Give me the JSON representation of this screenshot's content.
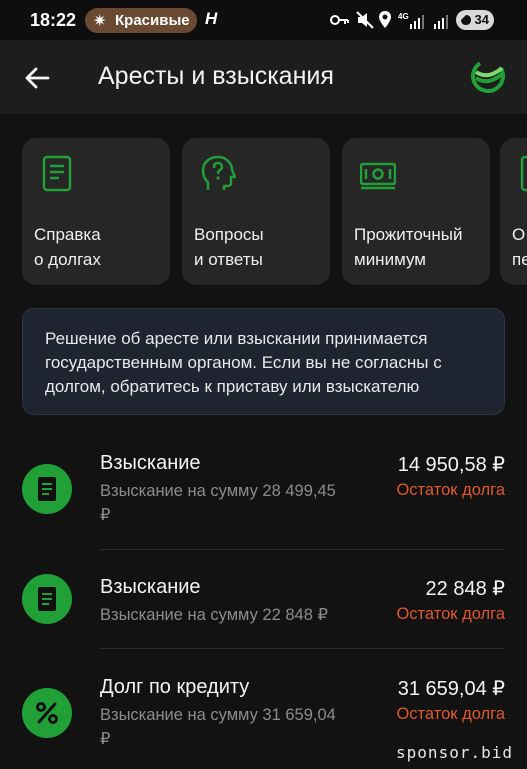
{
  "status_bar": {
    "time": "18:22",
    "notification": "Красивые",
    "notification_icon": "sparkle-icon",
    "app_icon_letter": "H",
    "icons": [
      "key-icon",
      "mute-icon",
      "location-icon",
      "4g-signal-icon",
      "signal-icon"
    ],
    "battery": "34"
  },
  "header": {
    "title": "Аресты и взыскания",
    "back_icon": "arrow-left-icon",
    "logo_icon": "sber-logo-icon",
    "brand_color": "#21a038"
  },
  "cards": [
    {
      "line1": "Справка",
      "line2": "о долгах",
      "icon": "document-icon"
    },
    {
      "line1": "Вопросы",
      "line2": "и ответы",
      "icon": "question-head-icon"
    },
    {
      "line1": "Прожиточный",
      "line2": "минимум",
      "icon": "banknote-icon"
    },
    {
      "line1": "О",
      "line2": "пе",
      "icon": "document-icon"
    }
  ],
  "info": {
    "text": "Решение об аресте или взыскании принимается государственным органом. Если вы не согласны с долгом, обратитесь к приставу или взыскателю"
  },
  "debts": [
    {
      "title": "Взыскание",
      "subtitle": "Взыскание на сумму 28 499,45 ₽",
      "amount": "14 950,58 ₽",
      "status": "Остаток долга",
      "icon": "document-icon"
    },
    {
      "title": "Взыскание",
      "subtitle": "Взыскание на сумму 22 848 ₽",
      "amount": "22 848 ₽",
      "status": "Остаток долга",
      "icon": "document-icon"
    },
    {
      "title": "Долг по кредиту",
      "subtitle": "Взыскание на сумму 31 659,04 ₽",
      "amount": "31 659,04 ₽",
      "status": "Остаток долга",
      "icon": "percent-icon"
    }
  ],
  "colors": {
    "status_orange": "#e0582b",
    "accent_green": "#21a038"
  },
  "watermark": "sponsor.bid"
}
